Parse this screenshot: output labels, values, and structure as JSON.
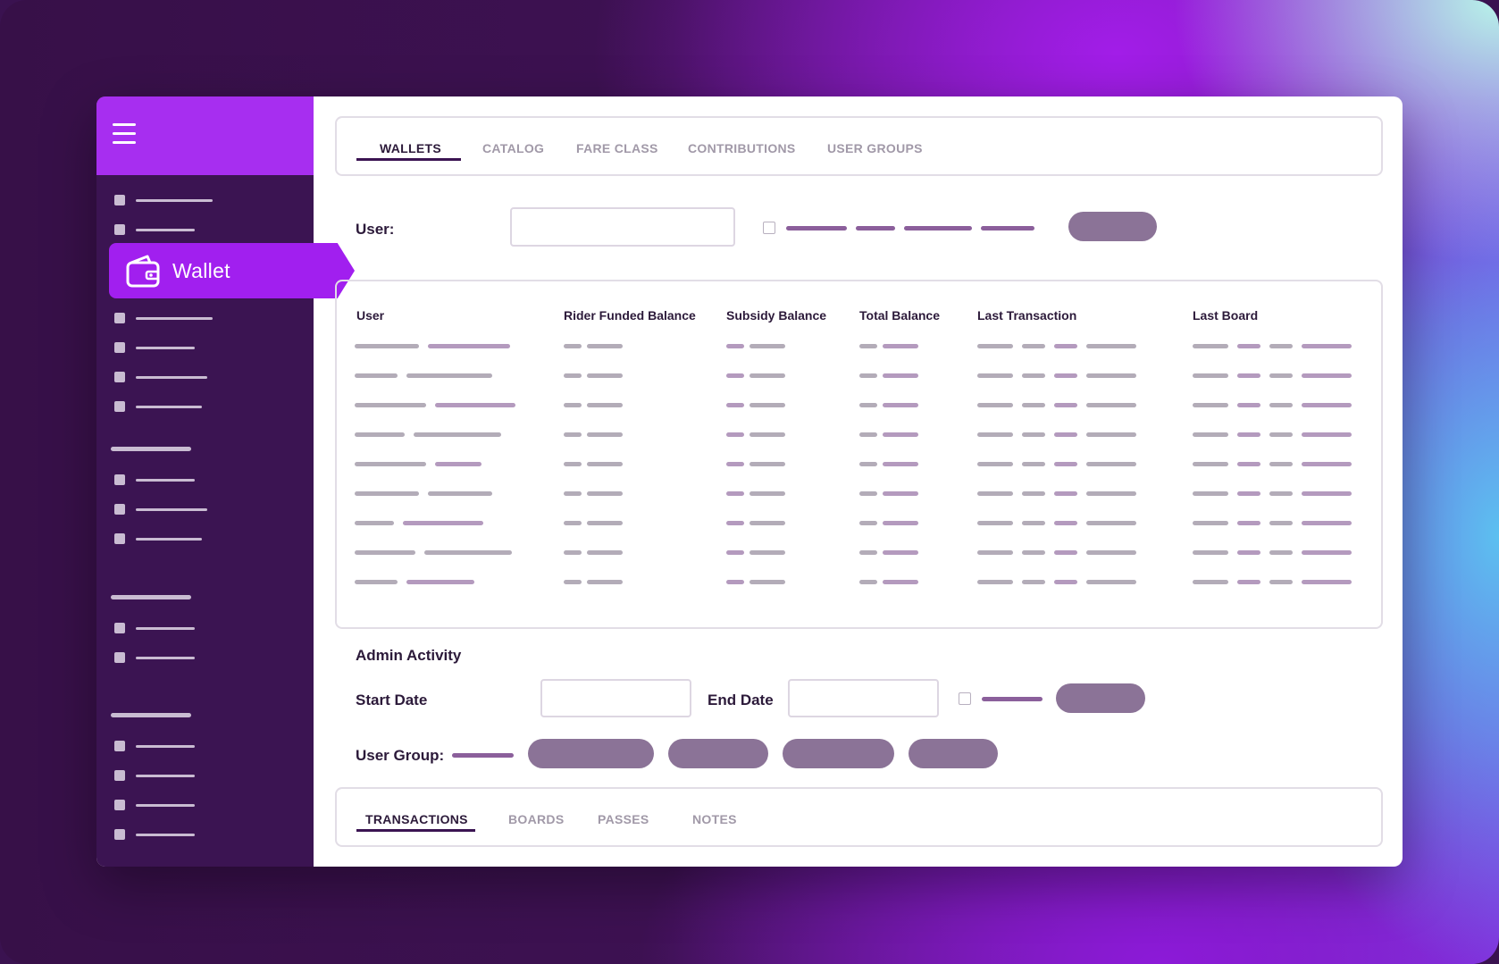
{
  "brand_colors": {
    "sidebar": "#3b1452",
    "sidebar_header": "#a72ef0",
    "active_item": "#a11fef",
    "button": "#8b7397",
    "accent_line": "#8b5f9b"
  },
  "sidebar": {
    "menu_icon": "hamburger-icon",
    "active_item": {
      "label": "Wallet",
      "icon": "wallet-icon"
    }
  },
  "top_tabs": [
    {
      "label": "WALLETS",
      "active": true
    },
    {
      "label": "CATALOG",
      "active": false
    },
    {
      "label": "FARE CLASS",
      "active": false
    },
    {
      "label": "CONTRIBUTIONS",
      "active": false
    },
    {
      "label": "USER GROUPS",
      "active": false
    }
  ],
  "filter": {
    "user_label": "User:",
    "user_value": ""
  },
  "table": {
    "columns": [
      "User",
      "Rider Funded Balance",
      "Subsidy Balance",
      "Total Balance",
      "Last Transaction",
      "Last Board"
    ]
  },
  "admin": {
    "title": "Admin Activity",
    "start_date_label": "Start Date",
    "end_date_label": "End Date",
    "user_group_label": "User Group:"
  },
  "bottom_tabs": [
    {
      "label": "TRANSACTIONS",
      "active": true
    },
    {
      "label": "BOARDS",
      "active": false
    },
    {
      "label": "PASSES",
      "active": false
    },
    {
      "label": "NOTES",
      "active": false
    }
  ]
}
